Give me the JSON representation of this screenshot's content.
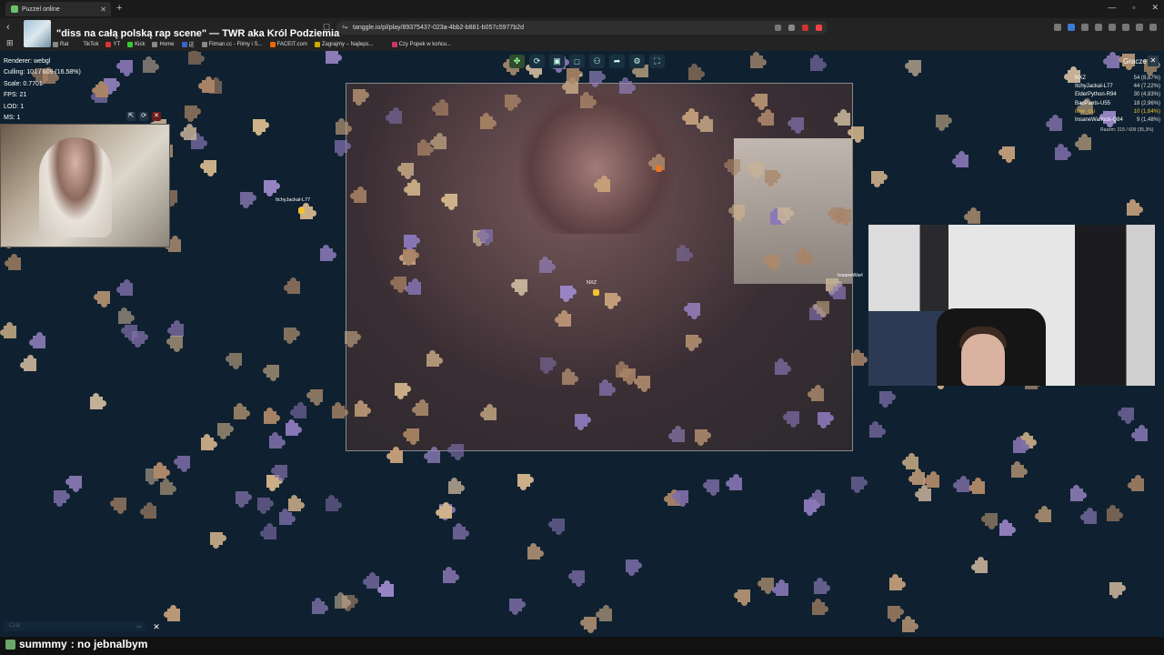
{
  "browser": {
    "tab_title": "Puzzel online",
    "url": "tanggle.io/pl/play/89375437-023a-4bb2-b881-b057c5977b2d",
    "bookmarks": [
      "Rat",
      "TikTok",
      "YT",
      "Kick",
      "Home",
      "这",
      "Filman.cc - Filmy i S...",
      "FACEIT.com",
      "Zagrajmy – Najleps...",
      "Czy Popek w końcu..."
    ],
    "bookmark_colors": [
      "#888",
      "#222",
      "#d33",
      "#3c3",
      "#888",
      "#36c",
      "#888",
      "#e60",
      "#ca0",
      "#c36"
    ]
  },
  "stream": {
    "title": "\"diss na całą polską rap scene\" — TWR aka Król Podziemia"
  },
  "debug": {
    "renderer": "Renderer: webgl",
    "culling": "Culling: 101 / 609 (16.58%)",
    "scale": "Scale: 0.7701",
    "fps": "FPS: 21",
    "lod": "LOD: 1",
    "ms": "MS: 1"
  },
  "players_panel": {
    "title": "Gracze",
    "close": "✕",
    "players": [
      {
        "name": "NXZ",
        "score": "54 (8,87%)",
        "color": "#ffffff"
      },
      {
        "name": "ItchyJackal-L77",
        "score": "44 (7,22%)",
        "color": "#ffffff"
      },
      {
        "name": "ElderPython-R94",
        "score": "30 (4,93%)",
        "color": "#ffffff"
      },
      {
        "name": "BadPants-U55",
        "score": "18 (2,96%)",
        "color": "#ffffff"
      },
      {
        "name": "now_ciu",
        "score": "10 (1,64%)",
        "color": "#f1c232"
      },
      {
        "name": "InsaneWarlock-Q84",
        "score": "9 (1,48%)",
        "color": "#ffffff"
      }
    ],
    "room_total": "Razem: 215 / 609 (35,3%)"
  },
  "cursors": [
    {
      "name": "ItchyJackal-L77"
    },
    {
      "name": "NXZ"
    },
    {
      "name": "InsaneWarl"
    }
  ],
  "chat": {
    "placeholder": "Czat",
    "message_user": "summmy",
    "message_text": ": no jebnalbym"
  }
}
